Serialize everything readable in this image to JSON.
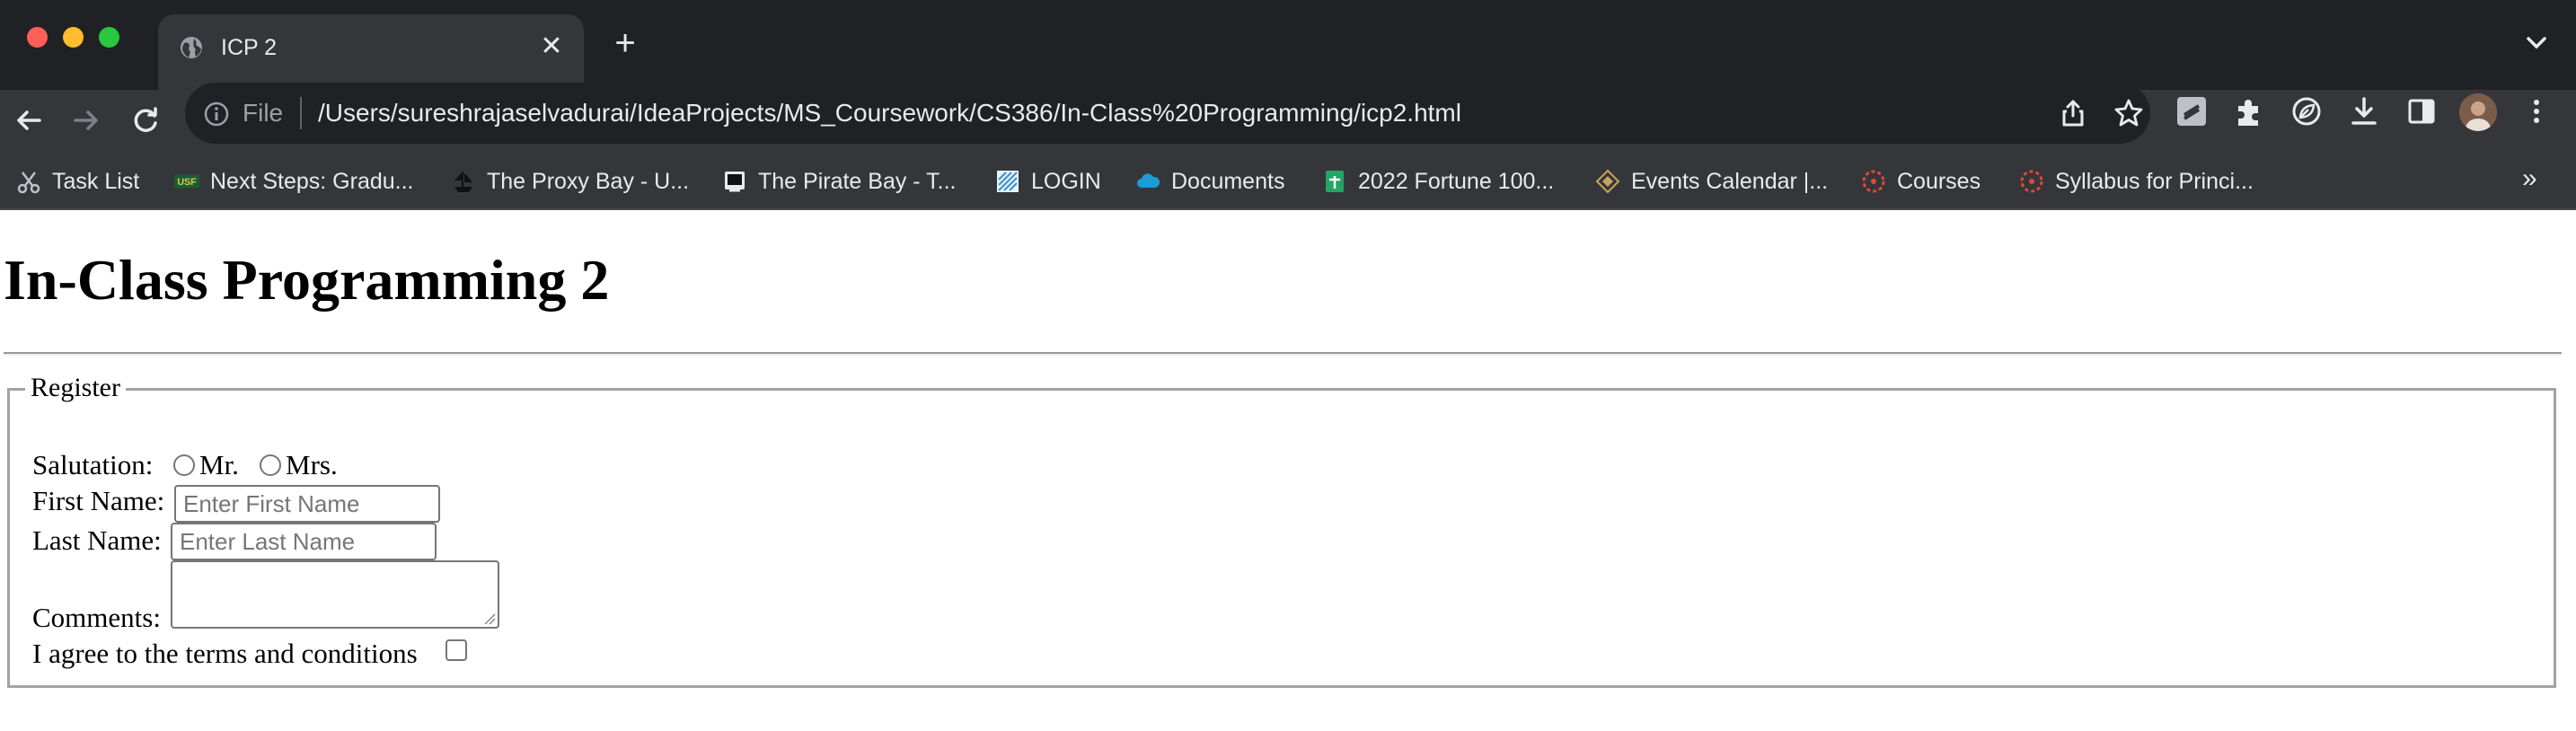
{
  "browser": {
    "tab": {
      "title": "ICP 2"
    },
    "address_bar": {
      "scheme_label": "File",
      "url": "/Users/sureshrajaselvadurai/IdeaProjects/MS_Coursework/CS386/In-Class%20Programming/icp2.html"
    },
    "bookmarks": [
      {
        "label": "Task List",
        "icon": "scissors-icon"
      },
      {
        "label": "Next Steps: Gradu...",
        "icon": "usf-icon"
      },
      {
        "label": "The Proxy Bay - U...",
        "icon": "pirate-ship-icon"
      },
      {
        "label": "The Pirate Bay - T...",
        "icon": "pirate-bay-icon"
      },
      {
        "label": "LOGIN",
        "icon": "login-icon"
      },
      {
        "label": "Documents",
        "icon": "cloud-icon"
      },
      {
        "label": "2022 Fortune 100...",
        "icon": "sheets-icon"
      },
      {
        "label": "Events Calendar |...",
        "icon": "calendar-diamond-icon"
      },
      {
        "label": "Courses",
        "icon": "canvas-icon"
      },
      {
        "label": "Syllabus for Princi...",
        "icon": "canvas-icon"
      }
    ],
    "bookmarks_overflow": "»",
    "colors": {
      "chrome": "#35363a",
      "tabstrip": "#202124",
      "omnibox": "#202124"
    }
  },
  "page": {
    "heading": "In-Class Programming 2",
    "form": {
      "legend": "Register",
      "salutation_label": "Salutation:",
      "salutation_options": [
        "Mr.",
        "Mrs."
      ],
      "first_name_label": "First Name:",
      "first_name_placeholder": "Enter First Name",
      "last_name_label": "Last Name:",
      "last_name_placeholder": "Enter Last Name",
      "comments_label": "Comments:",
      "terms_label": "I agree to the terms and conditions"
    }
  }
}
